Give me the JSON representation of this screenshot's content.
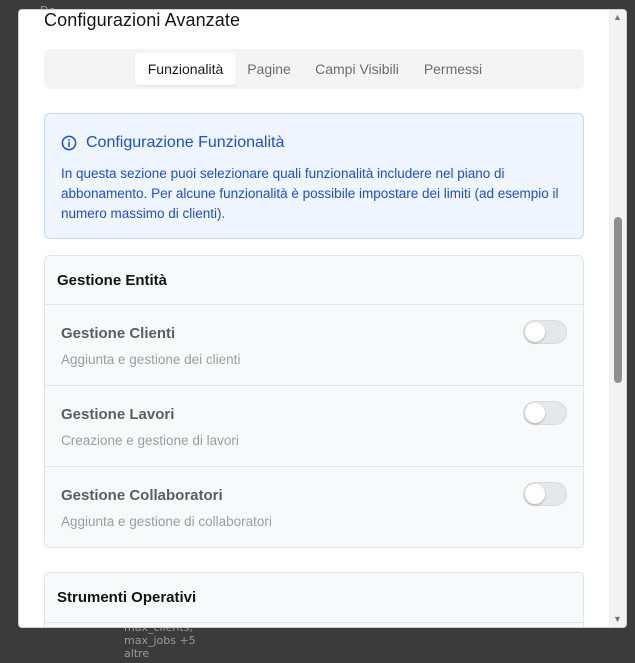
{
  "background": {
    "top_text": "De",
    "bottom_text": "max_clients,\nmax_jobs +5\naltre"
  },
  "modal": {
    "title": "Configurazioni Avanzate",
    "tabs": [
      {
        "label": "Funzionalità",
        "active": true
      },
      {
        "label": "Pagine",
        "active": false
      },
      {
        "label": "Campi Visibili",
        "active": false
      },
      {
        "label": "Permessi",
        "active": false
      }
    ],
    "info": {
      "icon": "info-circle-icon",
      "title": "Configurazione Funzionalità",
      "text": "In questa sezione puoi selezionare quali funzionalità includere nel piano di abbonamento. Per alcune funzionalità è possibile impostare dei limiti (ad esempio il numero massimo di clienti)."
    },
    "sections": [
      {
        "title": "Gestione Entità",
        "features": [
          {
            "name": "Gestione Clienti",
            "description": "Aggiunta e gestione dei clienti",
            "enabled": false
          },
          {
            "name": "Gestione Lavori",
            "description": "Creazione e gestione di lavori",
            "enabled": false
          },
          {
            "name": "Gestione Collaboratori",
            "description": "Aggiunta e gestione di collaboratori",
            "enabled": false
          }
        ]
      },
      {
        "title": "Strumenti Operativi",
        "features": []
      }
    ]
  },
  "colors": {
    "accent": "#1d4ed8",
    "info_bg": "#eff6ff",
    "info_border": "#bfdbfe",
    "toggle_off": "#e5e7eb"
  }
}
